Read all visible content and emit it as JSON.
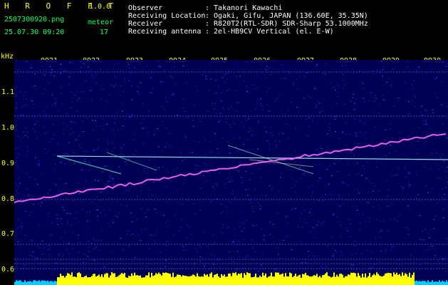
{
  "header": {
    "app_name": "H R O F F T",
    "version": "1.0.0",
    "filename": "2507300920.png",
    "datetime": "25.07.30 09:20",
    "meteor_label": "meteor",
    "meteor_count": "17",
    "fields": [
      {
        "label": "Observer",
        "value": ": Takanori Kawachi"
      },
      {
        "label": "Receiving Location",
        "value": ": Ogaki, Gifu, JAPAN (136.60E, 35.35N)"
      },
      {
        "label": "Receiver",
        "value": ": R820T2(RTL-SDR) SDR-Sharp 53.1000MHz"
      },
      {
        "label": "Receiving antenna",
        "value": ": 2el-HB9CV Vertical (el. E-W)"
      }
    ]
  },
  "spectrogram": {
    "unit": "kHz",
    "x_ticks": [
      "0921",
      "0922",
      "0923",
      "0924",
      "0925",
      "0926",
      "0927",
      "0928",
      "0929",
      "0930"
    ],
    "y_ticks": [
      "1.1",
      "1.0",
      "0.9",
      "0.8",
      "0.7",
      "0.6"
    ],
    "colors": {
      "background": "#000066",
      "noise": "#2233cc",
      "trace": "#ff66ff",
      "carrier": "#aaffff",
      "axis": "#ffff00",
      "level": "#ffff00",
      "level_low": "#00ccff"
    }
  }
}
